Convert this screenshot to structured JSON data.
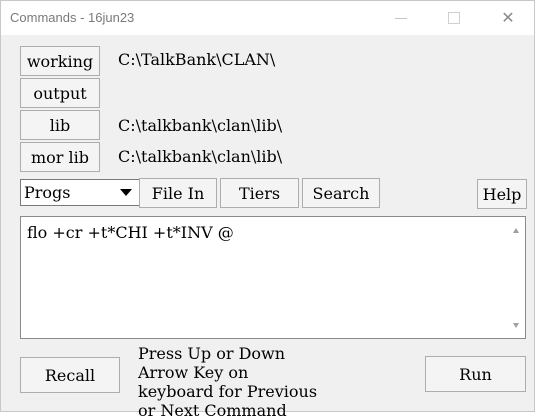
{
  "window": {
    "title": "Commands - 16jun23",
    "controls": {
      "minimize_icon": "minimize-icon",
      "maximize_icon": "maximize-icon",
      "close_icon": "close-icon",
      "close_glyph": "✕"
    }
  },
  "directories": {
    "working": {
      "label": "working",
      "path": "C:\\TalkBank\\CLAN\\"
    },
    "output": {
      "label": "output",
      "path": ""
    },
    "lib": {
      "label": "lib",
      "path": "C:\\talkbank\\clan\\lib\\"
    },
    "mor_lib": {
      "label": "mor lib",
      "path": "C:\\talkbank\\clan\\lib\\"
    }
  },
  "toolbar": {
    "progs_selected": "Progs",
    "file_in_label": "File In",
    "tiers_label": "Tiers",
    "search_label": "Search",
    "help_label": "Help"
  },
  "command": {
    "text": "flo +cr +t*CHI +t*INV @"
  },
  "bottom": {
    "recall_label": "Recall",
    "hint": "Press Up or Down Arrow Key on keyboard for Previous or Next Command",
    "run_label": "Run"
  }
}
